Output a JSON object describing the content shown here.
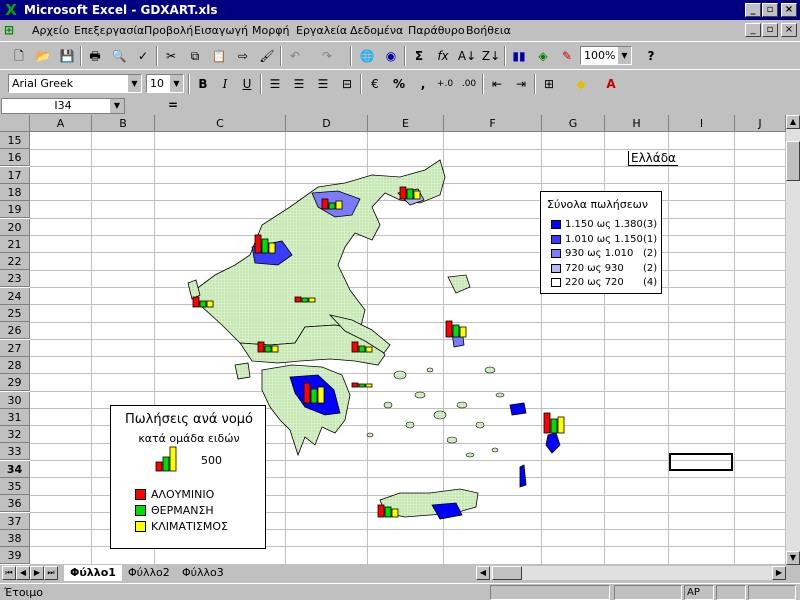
{
  "window": {
    "title": "Microsoft Excel - GDXART.xls"
  },
  "menu": [
    "Αρχείο",
    "Επεξεργασία",
    "Προβολή",
    "Εισαγωγή",
    "Μορφή",
    "Εργαλεία",
    "Δεδομένα",
    "Παράθυρο",
    "Βοήθεια"
  ],
  "toolbar": {
    "zoom": "100%",
    "font": "Arial Greek",
    "font_size": "10"
  },
  "formula_bar": {
    "name_box": "I34",
    "equals": "="
  },
  "columns": [
    "A",
    "B",
    "C",
    "D",
    "E",
    "F",
    "G",
    "H",
    "I",
    "J"
  ],
  "rows": [
    "15",
    "16",
    "17",
    "18",
    "19",
    "20",
    "21",
    "22",
    "23",
    "24",
    "25",
    "26",
    "27",
    "28",
    "29",
    "30",
    "31",
    "32",
    "33",
    "34",
    "35",
    "36",
    "37",
    "38",
    "39"
  ],
  "active_cell": "I34",
  "map": {
    "country_label": "Ελλάδα",
    "sales_legend": {
      "title": "Σύνολα πωλήσεων",
      "items": [
        {
          "label": "1.150 ως 1.380",
          "count": "(3)",
          "color": "#0000ff"
        },
        {
          "label": "1.010 ως 1.150",
          "count": "(1)",
          "color": "#3b3bff"
        },
        {
          "label": "930 ως 1.010",
          "count": "(2)",
          "color": "#7b7bff"
        },
        {
          "label": "720 ως 930",
          "count": "(2)",
          "color": "#b5b5ff"
        },
        {
          "label": "220 ως 720",
          "count": "(4)",
          "color": "#ffffff"
        }
      ]
    },
    "category_legend": {
      "title": "Πωλήσεις ανά νομό",
      "subtitle": "κατά ομάδα ειδών",
      "scale": "500",
      "items": [
        {
          "label": "ΑΛΟΥΜΙΝΙΟ",
          "color": "#ff0000"
        },
        {
          "label": "ΘΕΡΜΑΝΣΗ",
          "color": "#00dd00"
        },
        {
          "label": "ΚΛΙΜΑΤΙΣΜΟΣ",
          "color": "#ffff00"
        }
      ]
    }
  },
  "sheet_tabs": [
    "Φύλλο1",
    "Φύλλο2",
    "Φύλλο3"
  ],
  "status": {
    "text": "Έτοιμο",
    "indicator": "ΑΡ"
  }
}
